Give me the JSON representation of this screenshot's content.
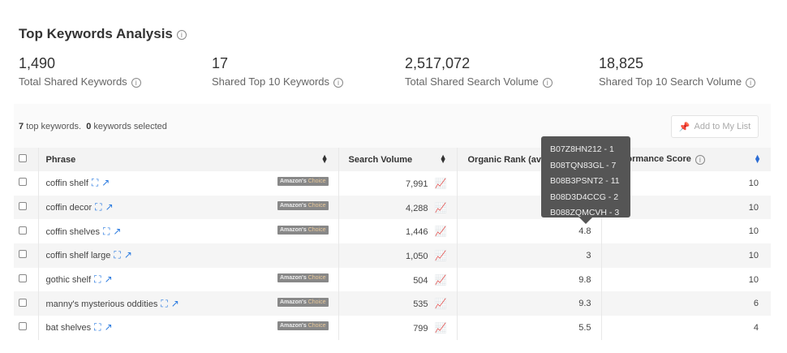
{
  "title": "Top Keywords Analysis",
  "stats": [
    {
      "value": "1,490",
      "label": "Total Shared Keywords"
    },
    {
      "value": "17",
      "label": "Shared Top 10 Keywords"
    },
    {
      "value": "2,517,072",
      "label": "Total Shared Search Volume"
    },
    {
      "value": "18,825",
      "label": "Shared Top 10 Search Volume"
    }
  ],
  "toolbar": {
    "top_count": "7",
    "top_label": "top keywords.",
    "selected_count": "0",
    "selected_label": "keywords selected",
    "add_label": "Add to My List"
  },
  "columns": {
    "phrase": "Phrase",
    "search_volume": "Search Volume",
    "organic_rank": "Organic Rank (avg)",
    "performance": "Performance Score"
  },
  "badge": {
    "amazons": "Amazon's",
    "choice": "Choice"
  },
  "rows": [
    {
      "phrase": "coffin shelf",
      "badge": true,
      "volume": "7,991",
      "rank": "",
      "score": "10"
    },
    {
      "phrase": "coffin decor",
      "badge": true,
      "volume": "4,288",
      "rank": "",
      "score": "10"
    },
    {
      "phrase": "coffin shelves",
      "badge": true,
      "volume": "1,446",
      "rank": "4.8",
      "score": "10"
    },
    {
      "phrase": "coffin shelf large",
      "badge": false,
      "volume": "1,050",
      "rank": "3",
      "score": "10"
    },
    {
      "phrase": "gothic shelf",
      "badge": true,
      "volume": "504",
      "rank": "9.8",
      "score": "10"
    },
    {
      "phrase": "manny's mysterious oddities",
      "badge": true,
      "volume": "535",
      "rank": "9.3",
      "score": "6"
    },
    {
      "phrase": "bat shelves",
      "badge": true,
      "volume": "799",
      "rank": "5.5",
      "score": "4"
    }
  ],
  "tooltip": [
    "B07Z8HN212 - 1",
    "B08TQN83GL - 7",
    "B08B3PSNT2 - 11",
    "B08D3D4CCG - 2",
    "B088ZQMCVH - 3"
  ]
}
